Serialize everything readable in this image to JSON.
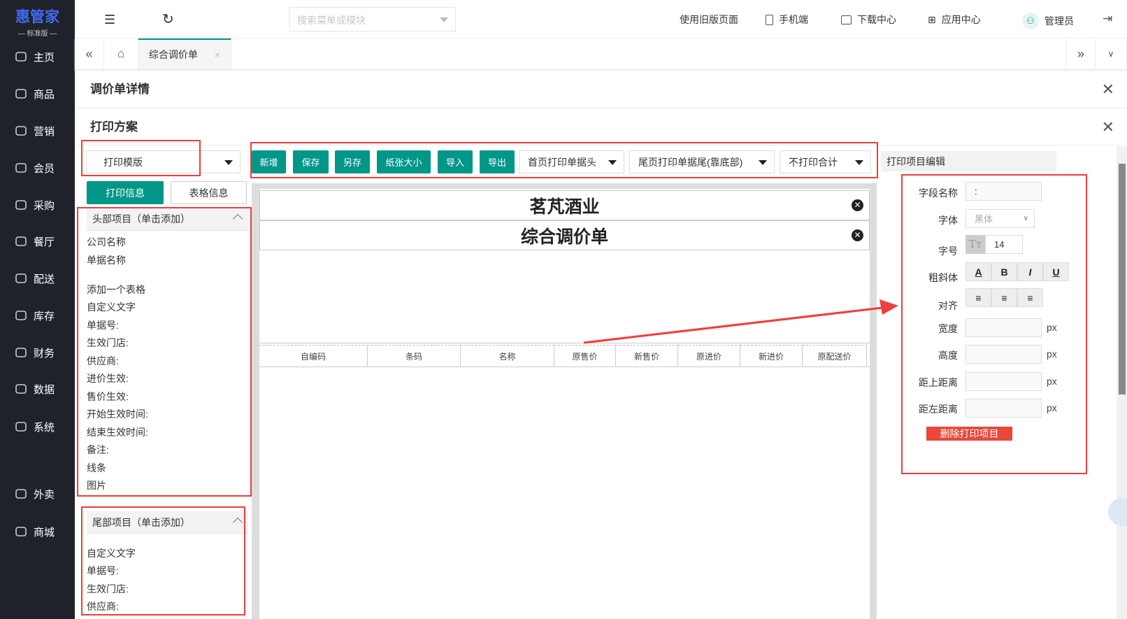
{
  "sidebar": {
    "logo": "惠管家",
    "edition": "— 标准版 —",
    "items": [
      {
        "label": "主页"
      },
      {
        "label": "商品"
      },
      {
        "label": "营销"
      },
      {
        "label": "会员"
      },
      {
        "label": "采购"
      },
      {
        "label": "餐厅"
      },
      {
        "label": "配送"
      },
      {
        "label": "库存"
      },
      {
        "label": "财务"
      },
      {
        "label": "数据"
      },
      {
        "label": "系统"
      },
      {
        "label": "外卖"
      },
      {
        "label": "商城"
      }
    ]
  },
  "topbar": {
    "search_placeholder": "搜索菜单或模块",
    "old_page": "使用旧版页面",
    "mobile": "手机端",
    "download": "下载中心",
    "apps": "应用中心",
    "user": "管理员"
  },
  "tabs": {
    "active": "综合调价单"
  },
  "detail_title": "调价单详情",
  "print_title": "打印方案",
  "left": {
    "template": "打印模版",
    "btn_print_info": "打印信息",
    "btn_table_info": "表格信息",
    "header_section": "头部项目（单击添加）",
    "header_items": [
      "公司名称",
      "单据名称",
      "添加一个表格",
      "自定义文字",
      "单据号:",
      "生效门店:",
      "供应商:",
      "进价生效:",
      "售价生效:",
      "开始生效时间:",
      "结束生效时间:",
      "备注:",
      "线条",
      "图片"
    ],
    "footer_section": "尾部项目（单击添加）",
    "footer_items": [
      "自定义文字",
      "单据号:",
      "生效门店:",
      "供应商:"
    ]
  },
  "toolbar": {
    "add": "新增",
    "save": "保存",
    "save_as": "另存",
    "paper_size": "纸张大小",
    "import": "导入",
    "export": "导出",
    "first_page_header": "首页打印单据头",
    "last_page_footer": "尾页打印单据尾(靠底部)",
    "total": "不打印合计"
  },
  "canvas": {
    "company": "茗芃酒业",
    "doc_name": "综合调价单",
    "columns": [
      "自编码",
      "条码",
      "名称",
      "原售价",
      "新售价",
      "原进价",
      "新进价",
      "原配送价"
    ]
  },
  "editor": {
    "title": "打印项目编辑",
    "field_name_label": "字段名称",
    "field_name_value": ":",
    "font_label": "字体",
    "font_value": "黑体",
    "size_label": "字号",
    "size_value": "14",
    "style_label": "粗斜体",
    "align_label": "对齐",
    "width_label": "宽度",
    "height_label": "高度",
    "top_label": "距上距离",
    "left_label": "距左距离",
    "unit": "px",
    "delete": "删除打印项目",
    "style_buttons": [
      "A",
      "B",
      "I",
      "U"
    ]
  },
  "colors": {
    "accent": "#009688",
    "highlight": "#f03c3c",
    "delete": "#e9473a",
    "sidebar": "#1f222b"
  }
}
